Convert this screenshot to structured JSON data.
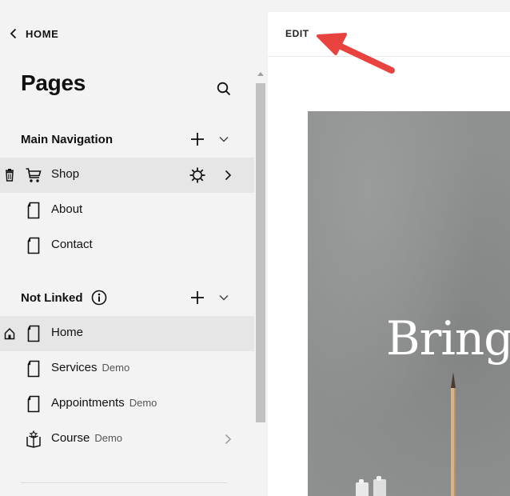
{
  "sidebar": {
    "back_label": "HOME",
    "title": "Pages",
    "sections": {
      "main_nav": {
        "label": "Main Navigation",
        "items": [
          {
            "label": "Shop"
          },
          {
            "label": "About"
          },
          {
            "label": "Contact"
          }
        ]
      },
      "not_linked": {
        "label": "Not Linked",
        "items": [
          {
            "label": "Home"
          },
          {
            "label": "Services",
            "badge": "Demo"
          },
          {
            "label": "Appointments",
            "badge": "Demo"
          },
          {
            "label": "Course",
            "badge": "Demo"
          }
        ]
      }
    }
  },
  "preview": {
    "edit_label": "EDIT",
    "hero_text": "Bringi"
  },
  "icons": {
    "back": "chevron-left-icon",
    "search": "search-icon",
    "add": "plus-icon",
    "collapse": "chevron-down-icon",
    "info": "info-icon",
    "trash": "trash-icon",
    "cart": "cart-icon",
    "page": "page-icon",
    "gear": "gear-icon",
    "home": "home-icon",
    "course": "open-book-icon",
    "callout": "red-arrow"
  },
  "colors": {
    "sidebar_bg": "#f3f3f3",
    "selected_row": "#e6e6e6",
    "callout_arrow": "#e8433f"
  }
}
